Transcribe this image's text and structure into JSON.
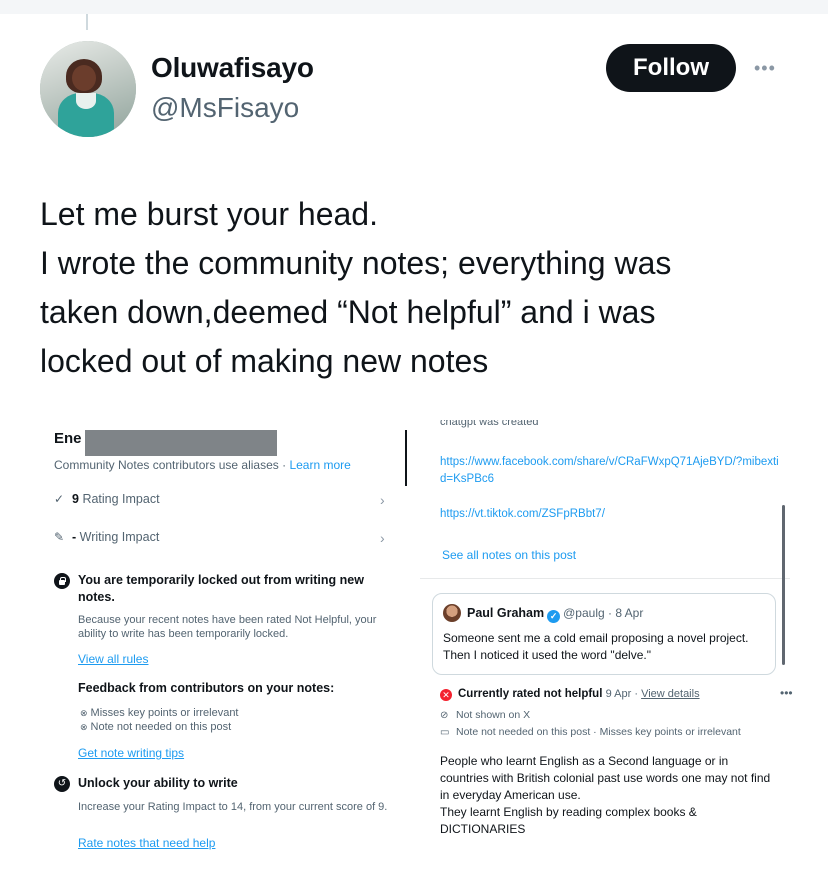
{
  "tweet": {
    "author_name": "Oluwafisayo",
    "author_handle": "@MsFisayo",
    "follow_label": "Follow",
    "more_label": "•••",
    "text_lines": [
      "Let me burst your head.",
      "I wrote the community notes; everything was",
      "taken down,deemed “Not helpful” and i was",
      "locked out of making new notes"
    ]
  },
  "left_shot": {
    "alias_prefix": "Ene",
    "contributors_text": "Community Notes contributors use aliases · ",
    "learn_more": "Learn more",
    "rating_value": "9",
    "rating_label": "Rating Impact",
    "writing_value": "-",
    "writing_label": "Writing Impact",
    "locked_title": "You are temporarily locked out from writing new notes.",
    "locked_desc": "Because your recent notes have been rated Not Helpful, your ability to write has been temporarily locked.",
    "view_rules": "View all rules",
    "feedback_title": "Feedback from contributors on your notes:",
    "feedback_items": [
      "Misses key points or irrelevant",
      "Note not needed on this post"
    ],
    "tips_link": "Get note writing tips",
    "unlock_title": "Unlock your ability to write",
    "unlock_desc": "Increase your Rating Impact to 14, from your current score of 9.",
    "rate_link": "Rate notes that need help"
  },
  "right_shot": {
    "cut_text": "chatgpt was created",
    "url_1": "https://www.facebook.com/share/v/CRaFWxpQ71AjeBYD/?mibextid=KsPBc6",
    "url_2": "https://vt.tiktok.com/ZSFpRBbt7/",
    "see_all": "See all notes on this post",
    "quote_name": "Paul Graham",
    "quote_meta": "@paulg · 8 Apr",
    "quote_text": "Someone sent me a cold email proposing a novel project. Then I noticed it used the word \"delve.\"",
    "status_title": "Currently rated not helpful",
    "status_date": "9 Apr · ",
    "status_link": "View details",
    "not_shown": "Not shown on X",
    "not_needed": "Note not needed on this post · Misses key points or irrelevant",
    "note_body": "People who learnt English as a Second language or in countries with British colonial past use words one may not find in everyday American use.\nThey learnt English by reading complex books & DICTIONARIES"
  },
  "colors": {
    "accent": "#1d9bf0",
    "text": "#0f1419",
    "muted": "#536471",
    "danger": "#f4212e"
  }
}
